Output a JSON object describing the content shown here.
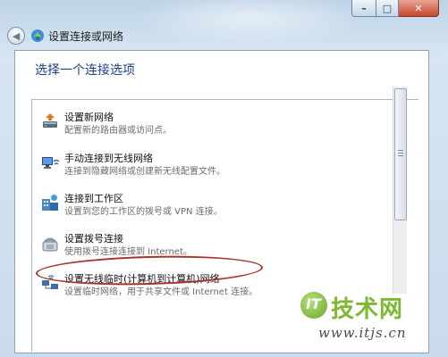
{
  "window": {
    "title": "设置连接或网络",
    "caption": {
      "minimize": "–",
      "maximize": "□",
      "close": "✕"
    }
  },
  "content": {
    "heading": "选择一个连接选项"
  },
  "options": [
    {
      "title": "设置新网络",
      "desc": "配置新的路由器或访问点。",
      "icon": "router-icon"
    },
    {
      "title": "手动连接到无线网络",
      "desc": "连接到隐藏网络或创建新无线配置文件。",
      "icon": "wireless-network-icon"
    },
    {
      "title": "连接到工作区",
      "desc": "设置到您的工作区的拨号或 VPN 连接。",
      "icon": "workplace-icon"
    },
    {
      "title": "设置拨号连接",
      "desc": "使用拨号连接连接到 Internet。",
      "icon": "dialup-phone-icon"
    },
    {
      "title": "设置无线临时(计算机到计算机)网络",
      "desc": "设置临时网络，用于共享文件或 Internet 连接。",
      "icon": "adhoc-network-icon"
    }
  ],
  "watermark": {
    "logo": "IT",
    "name": "技术网",
    "url": "www.itjs.cn"
  },
  "colors": {
    "heading": "#1e3f8c",
    "annotation": "#a8322a",
    "watermark_green": "#7cba2d"
  }
}
